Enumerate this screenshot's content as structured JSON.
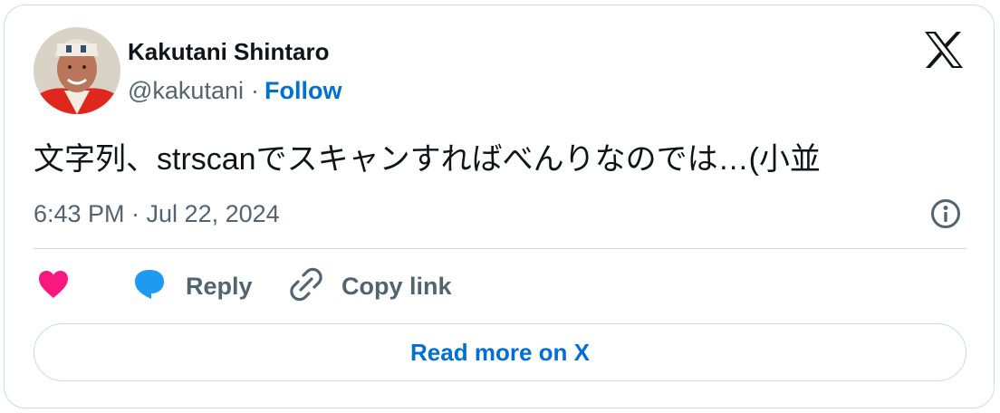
{
  "author": {
    "name": "Kakutani Shintaro",
    "handle": "@kakutani",
    "separator": "·",
    "follow_label": "Follow"
  },
  "tweet": {
    "text": "文字列、strscanでスキャンすればべんりなのでは…(小並",
    "timestamp": "6:43 PM · Jul 22, 2024"
  },
  "actions": {
    "like_icon": "heart-icon",
    "reply_label": "Reply",
    "reply_icon": "speech-bubble-icon",
    "copy_label": "Copy link",
    "copy_icon": "link-icon"
  },
  "read_more_label": "Read more on X",
  "colors": {
    "link": "#006fd6",
    "like": "#f91880",
    "reply": "#1d9bf0",
    "muted": "#536471",
    "text": "#0f1419",
    "border": "#cfd9de"
  }
}
